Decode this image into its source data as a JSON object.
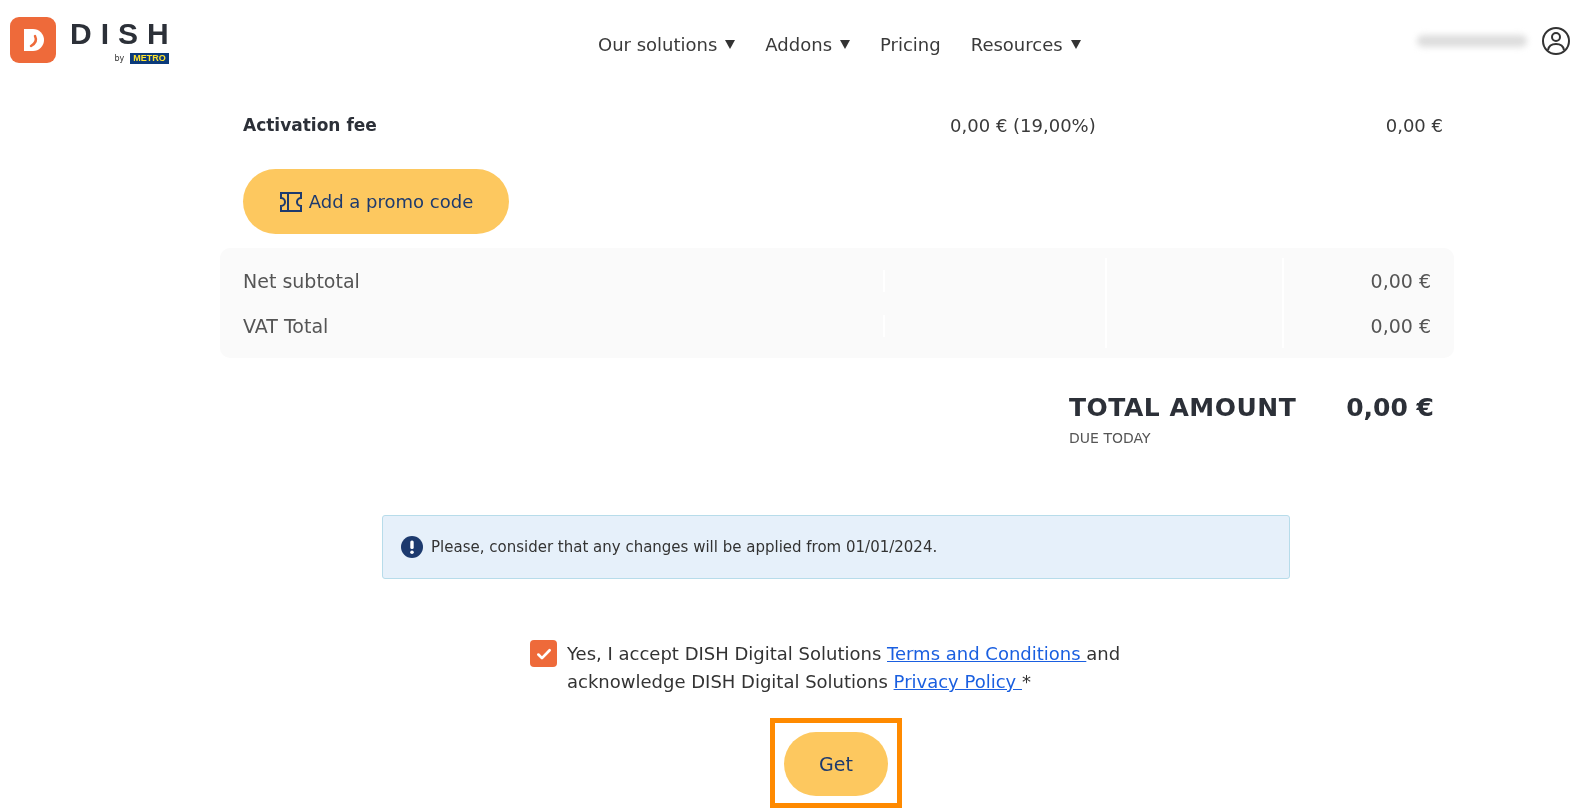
{
  "header": {
    "logo": {
      "wordmark": "DISH",
      "by": "by",
      "brand": "METRO"
    },
    "nav": [
      {
        "label": "Our solutions",
        "dropdown": true
      },
      {
        "label": "Addons",
        "dropdown": true
      },
      {
        "label": "Pricing",
        "dropdown": false
      },
      {
        "label": "Resources",
        "dropdown": true
      }
    ]
  },
  "fee_row": {
    "label": "Activation fee",
    "tax": "0,00 € (19,00%)",
    "amount": "0,00 €"
  },
  "promo_button": "Add a promo code",
  "summary": [
    {
      "label": "Net subtotal",
      "amount": "0,00 €"
    },
    {
      "label": "VAT Total",
      "amount": "0,00 €"
    }
  ],
  "total": {
    "label": "TOTAL AMOUNT",
    "note": "DUE TODAY",
    "amount": "0,00 €"
  },
  "notice": "Please, consider that any changes will be applied from 01/01/2024.",
  "consent": {
    "checked": true,
    "text_before": "Yes, I accept DISH Digital Solutions ",
    "terms_link": "Terms and Conditions ",
    "text_middle": "and acknowledge DISH Digital Solutions ",
    "privacy_link": "Privacy Policy ",
    "text_after": "*"
  },
  "submit_button": {
    "label": "Get",
    "highlighted": true
  }
}
